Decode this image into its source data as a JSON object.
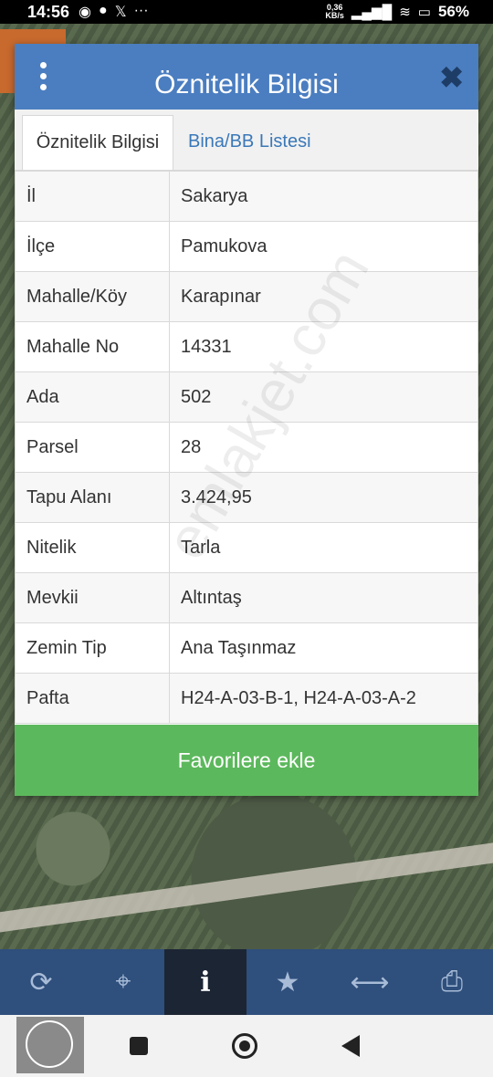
{
  "status_bar": {
    "time": "14:56",
    "network_speed": "0,36\nKB/s",
    "battery": "56%"
  },
  "dialog": {
    "title": "Öznitelik Bilgisi",
    "tabs": [
      {
        "label": "Öznitelik Bilgisi",
        "active": true
      },
      {
        "label": "Bina/BB Listesi",
        "active": false
      }
    ],
    "rows": [
      {
        "key": "İl",
        "value": "Sakarya"
      },
      {
        "key": "İlçe",
        "value": "Pamukova"
      },
      {
        "key": "Mahalle/Köy",
        "value": "Karapınar"
      },
      {
        "key": "Mahalle No",
        "value": "14331"
      },
      {
        "key": "Ada",
        "value": "502"
      },
      {
        "key": "Parsel",
        "value": "28"
      },
      {
        "key": "Tapu Alanı",
        "value": "3.424,95"
      },
      {
        "key": "Nitelik",
        "value": "Tarla"
      },
      {
        "key": "Mevkii",
        "value": "Altıntaş"
      },
      {
        "key": "Zemin Tip",
        "value": "Ana Taşınmaz"
      },
      {
        "key": "Pafta",
        "value": "H24-A-03-B-1, H24-A-03-A-2"
      }
    ],
    "favorite_button": "Favorilere ekle"
  },
  "watermark": "emlakjet.com",
  "toolbar": {
    "items": [
      {
        "icon": "refresh-icon",
        "glyph": "⟳"
      },
      {
        "icon": "locate-icon",
        "glyph": "⌖"
      },
      {
        "icon": "info-icon",
        "glyph": "i",
        "active": true
      },
      {
        "icon": "star-icon",
        "glyph": "★"
      },
      {
        "icon": "measure-icon",
        "glyph": "⟷"
      },
      {
        "icon": "print-icon",
        "glyph": "⎙"
      }
    ]
  },
  "colors": {
    "header": "#4b7ec0",
    "favorite": "#5cb85c",
    "toolbar": "#2f4f7c",
    "toolbar_active": "#1c2534"
  }
}
